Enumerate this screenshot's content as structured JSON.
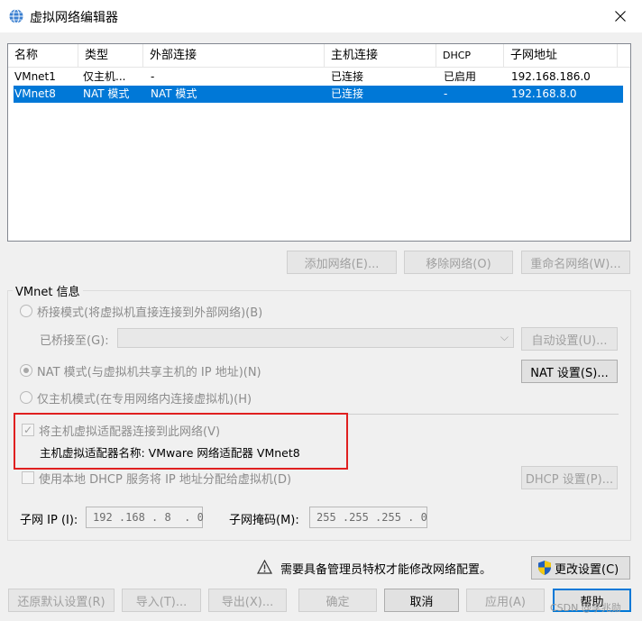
{
  "window": {
    "title": "虚拟网络编辑器"
  },
  "list": {
    "columns": [
      "名称",
      "类型",
      "外部连接",
      "主机连接",
      "DHCP",
      "子网地址"
    ],
    "rows": [
      {
        "name": "VMnet1",
        "type": "仅主机...",
        "external": "-",
        "host": "已连接",
        "dhcp": "已启用",
        "subnet": "192.168.186.0",
        "selected": false
      },
      {
        "name": "VMnet8",
        "type": "NAT 模式",
        "external": "NAT 模式",
        "host": "已连接",
        "dhcp": "-",
        "subnet": "192.168.8.0",
        "selected": true
      }
    ]
  },
  "list_buttons": {
    "add": "添加网络(E)...",
    "remove": "移除网络(O)",
    "rename": "重命名网络(W)..."
  },
  "vmnet_info": {
    "title": "VMnet 信息",
    "bridged_label": "桥接模式(将虚拟机直接连接到外部网络)(B)",
    "bridged_to_label": "已桥接至(G):",
    "bridged_to_value": "",
    "auto_settings": "自动设置(U)...",
    "nat_label": "NAT 模式(与虚拟机共享主机的 IP 地址)(N)",
    "nat_settings": "NAT 设置(S)...",
    "hostonly_label": "仅主机模式(在专用网络内连接虚拟机)(H)",
    "connect_adapter_label": "将主机虚拟适配器连接到此网络(V)",
    "adapter_name_label": "主机虚拟适配器名称: VMware 网络适配器 VMnet8",
    "dhcp_label": "使用本地 DHCP 服务将 IP 地址分配给虚拟机(D)",
    "dhcp_settings": "DHCP 设置(P)...",
    "subnet_ip_label": "子网 IP (I):",
    "subnet_ip_value": "192 .168 . 8  . 0",
    "subnet_mask_label": "子网掩码(M):",
    "subnet_mask_value": "255 .255 .255 . 0",
    "selected_mode": "nat",
    "connect_adapter_checked": true,
    "dhcp_checked": false
  },
  "admin": {
    "notice": "需要具备管理员特权才能修改网络配置。",
    "change_settings": "更改设置(C)"
  },
  "footer_buttons": {
    "restore": "还原默认设置(R)",
    "import": "导入(T)...",
    "export": "导出(X)...",
    "ok": "确定",
    "cancel": "取消",
    "apply": "应用(A)",
    "help": "帮助"
  },
  "watermark": "CSDN @李兆勋",
  "colors": {
    "selection": "#0078d7",
    "highlight_box": "#e02020",
    "shield_blue": "#1f5fbf",
    "shield_yellow": "#f2c811"
  }
}
